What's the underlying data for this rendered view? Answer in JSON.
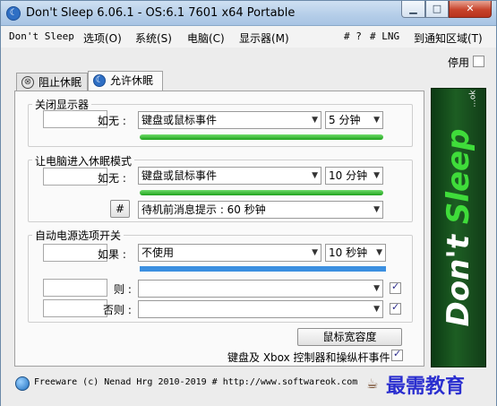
{
  "window": {
    "title": "Don't Sleep 6.06.1 - OS:6.1 7601 x64 Portable"
  },
  "menu": {
    "items": [
      "Don't Sleep",
      "选项(O)",
      "系统(S)",
      "电脑(C)",
      "显示器(M)",
      "# ?",
      "# LNG",
      "到通知区域(T)"
    ]
  },
  "stop": {
    "label": "停用",
    "checked": false
  },
  "tabs": [
    {
      "label": "阻止休眠",
      "icon": "block-icon",
      "active": false
    },
    {
      "label": "允许休眠",
      "icon": "moon-icon",
      "active": true
    }
  ],
  "display_off": {
    "title": "关闭显示器",
    "if_label": "如无 :",
    "event": "键盘或鼠标事件",
    "time": "5 分钟",
    "progress": 1.0
  },
  "sleep_mode": {
    "title": "让电脑进入休眠模式",
    "if_label": "如无 :",
    "event": "键盘或鼠标事件",
    "time": "10 分钟",
    "progress": 1.0,
    "hash_button": "#",
    "notice": "待机前消息提示 : 60 秒钟"
  },
  "power_options": {
    "title": "自动电源选项开关",
    "if_label": "如果 :",
    "condition": "不使用",
    "time": "10 秒钟",
    "progress": 1.0,
    "then_label": "则 :",
    "then_value": "",
    "then_checked": true,
    "else_label": "否则 :",
    "else_value": "",
    "else_checked": true
  },
  "mouse_tolerance_button": "鼠标宽容度",
  "xbox_option": {
    "label": "键盘及 Xbox 控制器和操纵杆事件",
    "checked": true
  },
  "logo": {
    "dont": "Don't",
    "sleep": "Sleep",
    "ok": "...ok"
  },
  "status": {
    "text": "Freeware (c) Nenad Hrg 2010-2019 # http://www.softwareok.com"
  },
  "watermark": "最需教育",
  "colors": {
    "progress_green": "#1ea11b",
    "progress_blue": "#3b8fe0",
    "logo_green": "#3fdc3a",
    "close_red": "#c7432b"
  }
}
